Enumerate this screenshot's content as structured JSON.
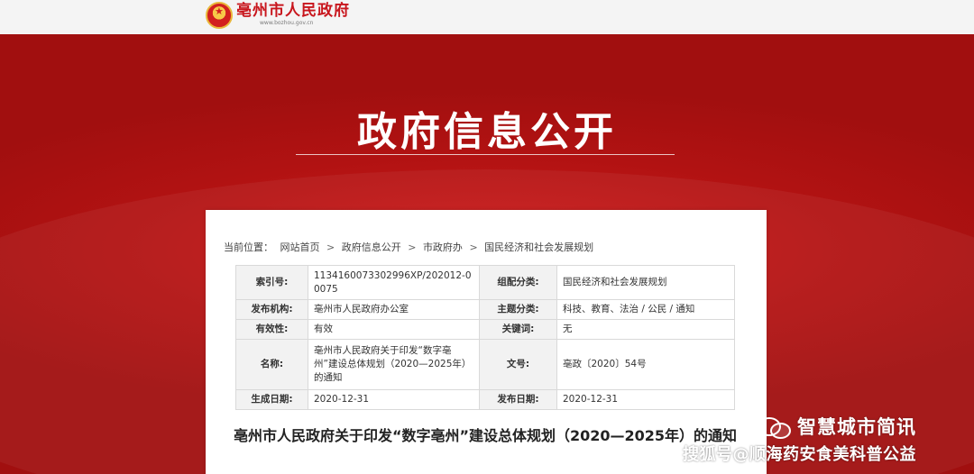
{
  "header": {
    "site_title": "亳州市人民政府",
    "site_url": "www.bozhou.gov.cn"
  },
  "banner": {
    "title": "政府信息公开"
  },
  "breadcrumb": {
    "label": "当前位置：",
    "items": [
      "网站首页",
      "政府信息公开",
      "市政府办",
      "国民经济和社会发展规划"
    ],
    "separator": ">"
  },
  "meta": {
    "index_no_label": "索引号:",
    "index_no": "1134160073302996XP/202012-00075",
    "category_label": "组配分类:",
    "category": "国民经济和社会发展规划",
    "publisher_label": "发布机构:",
    "publisher": "亳州市人民政府办公室",
    "topic_label": "主题分类:",
    "topic": "科技、教育、法治 / 公民 / 通知",
    "validity_label": "有效性:",
    "validity": "有效",
    "keywords_label": "关键词:",
    "keywords": "无",
    "name_label": "名称:",
    "name": "亳州市人民政府关于印发“数字亳州”建设总体规划（2020—2025年）的通知",
    "doc_no_label": "文号:",
    "doc_no": "亳政〔2020〕54号",
    "created_label": "生成日期:",
    "created": "2020-12-31",
    "published_label": "发布日期:",
    "published": "2020-12-31"
  },
  "document": {
    "title": "亳州市人民政府关于印发“数字亳州”建设总体规划（2020—2025年）的通知"
  },
  "watermarks": {
    "account": "智慧城市简讯",
    "source": "搜狐号@顺海药安食美科普公益"
  },
  "colors": {
    "brand_red": "#c8161d",
    "banner_red": "#b11212"
  }
}
